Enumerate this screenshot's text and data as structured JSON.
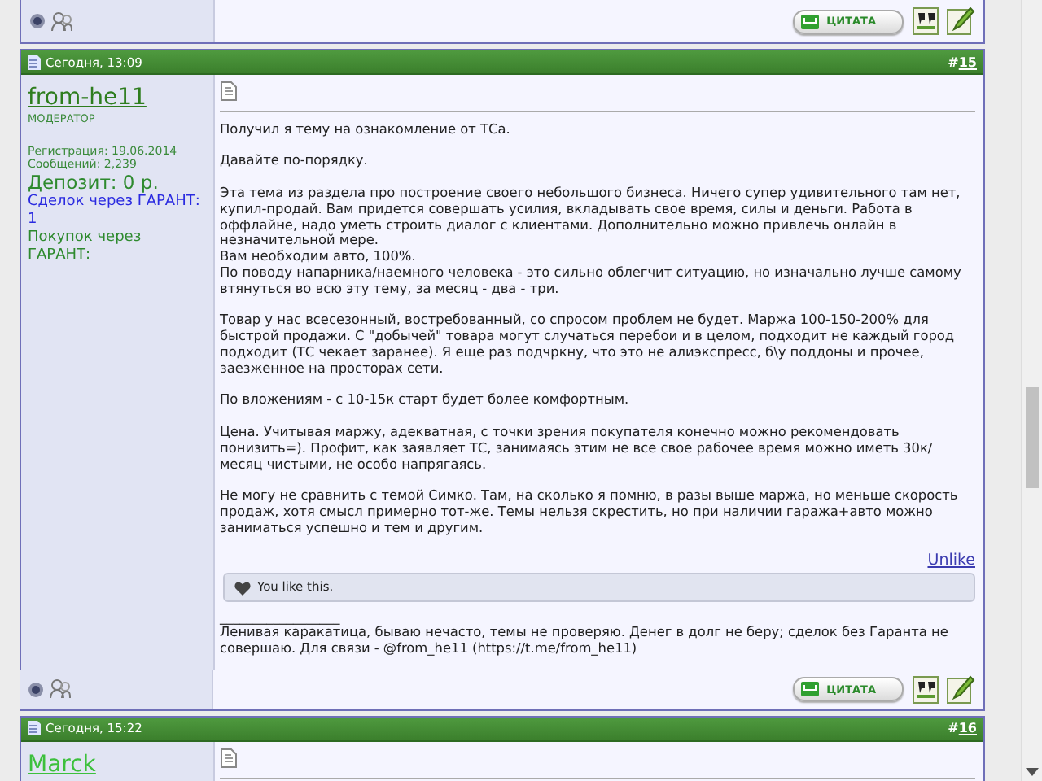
{
  "previous_post": {
    "online": true,
    "quote_button": "ЦИТАТА"
  },
  "posts": [
    {
      "date": "Сегодня, 13:09",
      "number_prefix": "#",
      "number": "15",
      "user": {
        "name": "from-he11",
        "title": "МОДЕРАТОР",
        "stats": [
          "Регистрация: 19.06.2014",
          "Сообщений: 2,239"
        ],
        "deposit": "Депозит: 0 р.",
        "deals": "Сделок через ГАРАНТ: 1",
        "purchases": "Покупок через ГАРАНТ:"
      },
      "paragraphs": [
        "Получил я тему на ознакомление от ТСа.",
        "Давайте по-порядку.",
        "Эта тема из раздела про построение своего небольшого бизнеса. Ничего супер удивительного там нет, купил-продай. Вам придется совершать усилия, вкладывать свое время, силы и деньги. Работа в оффлайне, надо уметь строить диалог с клиентами. Дополнительно можно привлечь онлайн в незначительной мере.\nВам необходим авто, 100%.\nПо поводу напарника/наемного человека - это сильно облегчит ситуацию, но изначально лучше самому втянуться во всю эту тему, за месяц - два - три.",
        "Товар у нас всесезонный, востребованный, со спросом проблем не будет. Маржа 100-150-200% для быстрой продажи. С \"добычей\" товара могут случаться перебои и в целом, подходит не каждый город подходит (ТС чекает заранее). Я еще раз подчркну, что это не алиэкспресс, б\\у поддоны и прочее, заезженное на просторах сети.",
        "По вложениям - с 10-15к старт будет более комфортным.",
        "Цена. Учитывая маржу, адекватная, с точки зрения покупателя конечно можно рекомендовать понизить=). Профит, как заявляет ТС, занимаясь этим не все свое рабочее время можно иметь 30к/ месяц чистыми, не особо напрягаясь.",
        "Не могу не сравнить с темой Симко. Там, на сколько я помню, в разы выше маржа, но меньше скорость продаж, хотя смысл примерно тот-же. Темы нельзя скрестить, но при наличии гаража+авто можно заниматься успешно и тем и другим."
      ],
      "unlike": "Unlike",
      "likes": "You like this.",
      "signature_rule": "__________________",
      "signature": "Ленивая каракатица, бываю нечасто, темы не проверяю. Денег в долг не беру; сделок без Гаранта не совершаю. Для связи - @from_he11 (https://t.me/from_he11)",
      "online": true,
      "quote_button": "ЦИТАТА"
    },
    {
      "date": "Сегодня, 15:22",
      "number_prefix": "#",
      "number": "16",
      "user": {
        "name": "Marck"
      }
    }
  ]
}
